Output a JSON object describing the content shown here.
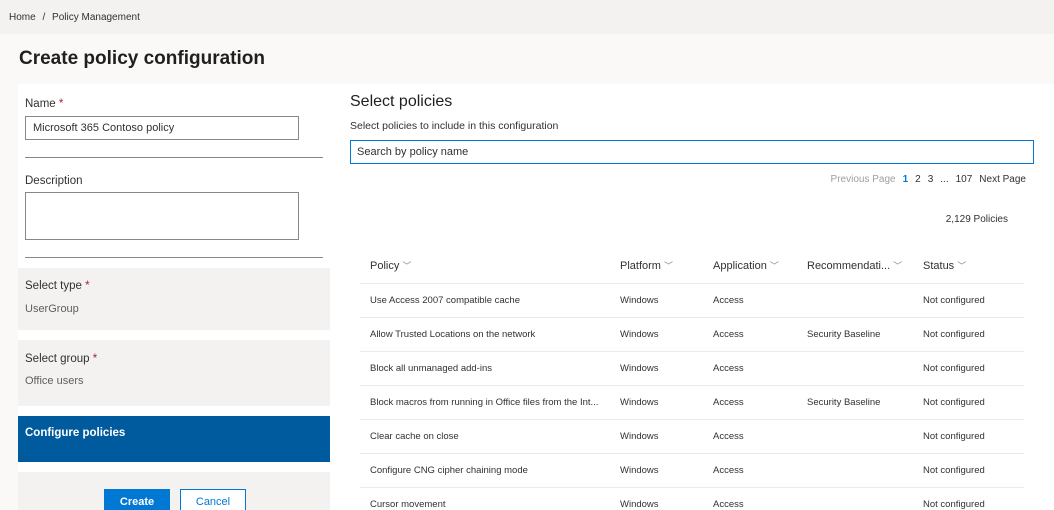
{
  "breadcrumb": {
    "home": "Home",
    "sep": "/",
    "current": "Policy Management"
  },
  "page_title": "Create policy configuration",
  "form": {
    "name_label": "Name",
    "required_mark": "*",
    "name_value": "Microsoft 365 Contoso policy",
    "description_label": "Description",
    "description_value": ""
  },
  "steps": {
    "select_type_label": "Select type",
    "select_type_value": "UserGroup",
    "select_group_label": "Select group",
    "select_group_value": "Office users",
    "configure_label": "Configure policies"
  },
  "actions": {
    "create": "Create",
    "cancel": "Cancel"
  },
  "main": {
    "title": "Select policies",
    "subtitle": "Select policies to include in this configuration",
    "search_placeholder": "Search by policy name",
    "pager": {
      "prev": "Previous Page",
      "p1": "1",
      "p2": "2",
      "p3": "3",
      "ellipsis": "...",
      "last": "107",
      "next": "Next Page"
    },
    "count": "2,129 Policies",
    "columns": {
      "policy": "Policy",
      "platform": "Platform",
      "application": "Application",
      "recommendation": "Recommendati...",
      "status": "Status"
    },
    "rows": [
      {
        "policy": "Use Access 2007 compatible cache",
        "platform": "Windows",
        "application": "Access",
        "recommendation": "",
        "status": "Not configured"
      },
      {
        "policy": "Allow Trusted Locations on the network",
        "platform": "Windows",
        "application": "Access",
        "recommendation": "Security Baseline",
        "status": "Not configured"
      },
      {
        "policy": "Block all unmanaged add-ins",
        "platform": "Windows",
        "application": "Access",
        "recommendation": "",
        "status": "Not configured"
      },
      {
        "policy": "Block macros from running in Office files from the Int...",
        "platform": "Windows",
        "application": "Access",
        "recommendation": "Security Baseline",
        "status": "Not configured"
      },
      {
        "policy": "Clear cache on close",
        "platform": "Windows",
        "application": "Access",
        "recommendation": "",
        "status": "Not configured"
      },
      {
        "policy": "Configure CNG cipher chaining mode",
        "platform": "Windows",
        "application": "Access",
        "recommendation": "",
        "status": "Not configured"
      },
      {
        "policy": "Cursor movement",
        "platform": "Windows",
        "application": "Access",
        "recommendation": "",
        "status": "Not configured"
      }
    ]
  },
  "icons": {
    "sort": "chevron-down-icon"
  },
  "colors": {
    "accent": "#0078d4",
    "active_step": "#005a9e",
    "required": "#a4262c"
  }
}
